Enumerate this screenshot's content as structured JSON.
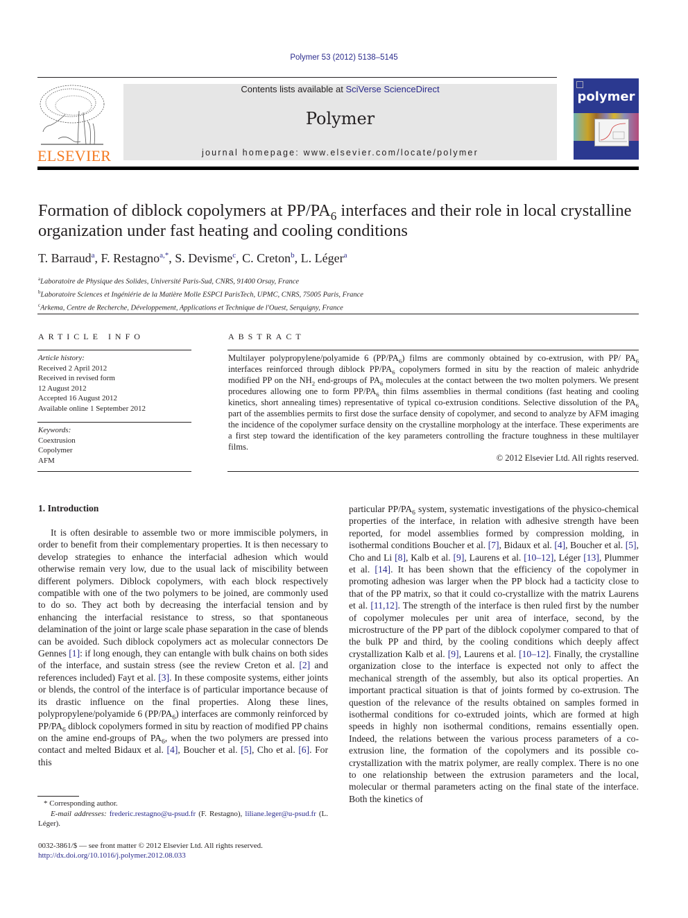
{
  "header": {
    "citation": "Polymer 53 (2012) 5138–5145",
    "contents_prefix": "Contents lists available at ",
    "contents_link": "SciVerse ScienceDirect",
    "journal_name": "Polymer",
    "homepage": "journal homepage: www.elsevier.com/locate/polymer",
    "publisher_logo_text": "ELSEVIER",
    "cover_title": "polymer",
    "colors": {
      "publisher_orange": "#f47920",
      "link_blue": "#2a2a8c",
      "cover_blue": "#2b3990",
      "banner_gray": "#e6e6e6"
    }
  },
  "article": {
    "title_part1": "Formation of diblock copolymers at PP/PA",
    "title_sub": "6",
    "title_part2": " interfaces and their role in local crystalline organization under fast heating and cooling conditions",
    "authors": [
      {
        "name": "T. Barraud",
        "sup": "a"
      },
      {
        "name": "F. Restagno",
        "sup": "a,*"
      },
      {
        "name": "S. Devisme",
        "sup": "c"
      },
      {
        "name": "C. Creton",
        "sup": "b"
      },
      {
        "name": "L. Léger",
        "sup": "a"
      }
    ],
    "affiliations": [
      {
        "key": "a",
        "text": "Laboratoire de Physique des Solides, Université Paris-Sud, CNRS, 91400 Orsay, France"
      },
      {
        "key": "b",
        "text": "Laboratoire Sciences et Ingéniérie de la Matière Molle ESPCI ParisTech, UPMC, CNRS, 75005 Paris, France"
      },
      {
        "key": "c",
        "text": "Arkema, Centre de Recherche, Développement, Applications et Technique de l'Ouest, Serquigny, France"
      }
    ]
  },
  "article_info": {
    "heading": "ARTICLE INFO",
    "history_label": "Article history:",
    "history": [
      "Received 2 April 2012",
      "Received in revised form",
      "12 August 2012",
      "Accepted 16 August 2012",
      "Available online 1 September 2012"
    ],
    "keywords_label": "Keywords:",
    "keywords": [
      "Coextrusion",
      "Copolymer",
      "AFM"
    ]
  },
  "abstract": {
    "heading": "ABSTRACT",
    "copyright": "© 2012 Elsevier Ltd. All rights reserved."
  },
  "intro": {
    "heading": "1.  Introduction"
  },
  "footnotes": {
    "corresponding": "* Corresponding author.",
    "email_label": "E-mail addresses:",
    "email1": "frederic.restagno@u-psud.fr",
    "email1_name": " (F. Restagno), ",
    "email2": "liliane.leger@u-psud.fr",
    "email2_name": " (L. Léger).",
    "issn": "0032-3861/$ — see front matter © 2012 Elsevier Ltd. All rights reserved.",
    "doi": "http://dx.doi.org/10.1016/j.polymer.2012.08.033"
  }
}
